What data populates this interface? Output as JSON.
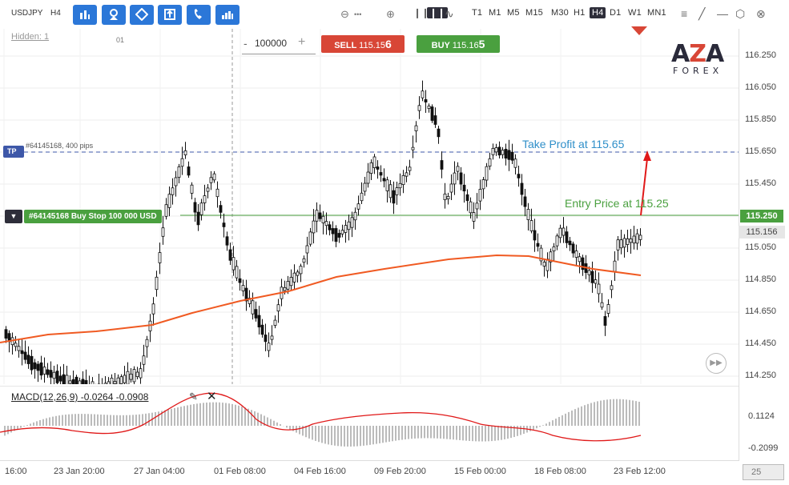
{
  "symbol": "USDJPY",
  "timeframe": "H4",
  "toolbar_buttons": [
    "chart-type-icon",
    "indicators-icon",
    "drawing-icon",
    "templates-icon",
    "trade-icon",
    "stats-icon"
  ],
  "zoom": {
    "minus": "⊖",
    "dots": "•••",
    "plus": "⊕"
  },
  "timeframes": [
    "T1",
    "M1",
    "M5",
    "M15",
    "M30",
    "H1",
    "H4",
    "D1",
    "W1",
    "MN1"
  ],
  "active_timeframe": "H4",
  "hidden_label": "Hidden: 1",
  "hidden_count": "01",
  "quantity": {
    "minus": "-",
    "value": "100000",
    "plus": "+"
  },
  "sell": {
    "label": "SELL",
    "price_main": "115.15",
    "price_big": "6"
  },
  "buy": {
    "label": "BUY",
    "price_main": "115.16",
    "price_big": "5"
  },
  "tp_order": {
    "tag": "TP",
    "text": "#64145168, 400 pips"
  },
  "entry_order": {
    "text": "#64145168 Buy Stop 100 000 USD"
  },
  "annotations": {
    "take_profit": "Take Profit at 115.65",
    "entry_price": "Entry Price at 115.25"
  },
  "price_scale": [
    "116.250",
    "116.050",
    "115.850",
    "115.650",
    "115.450",
    "115.250",
    "115.050",
    "114.850",
    "114.650",
    "114.450",
    "114.250"
  ],
  "entry_price_label": "115.250",
  "current_price_label": "115.156",
  "macd": {
    "title": "MACD(12,26,9) -0.0264 -0.0908",
    "scale_top": "0.1124",
    "scale_bottom": "-0.2099"
  },
  "time_axis": [
    "16:00",
    "23 Jan 20:00",
    "27 Jan 04:00",
    "01 Feb 08:00",
    "04 Feb 16:00",
    "09 Feb 20:00",
    "15 Feb 00:00",
    "18 Feb 08:00",
    "23 Feb 12:00"
  ],
  "bar_count": "25",
  "logo": {
    "top_a": "A",
    "top_z": "Z",
    "top_a2": "A",
    "sub": "FOREX"
  },
  "colors": {
    "accent": "#2b77d8",
    "sell": "#d84636",
    "buy": "#4aa03f",
    "tp": "#3d57a8",
    "ma": "#f05a22"
  }
}
